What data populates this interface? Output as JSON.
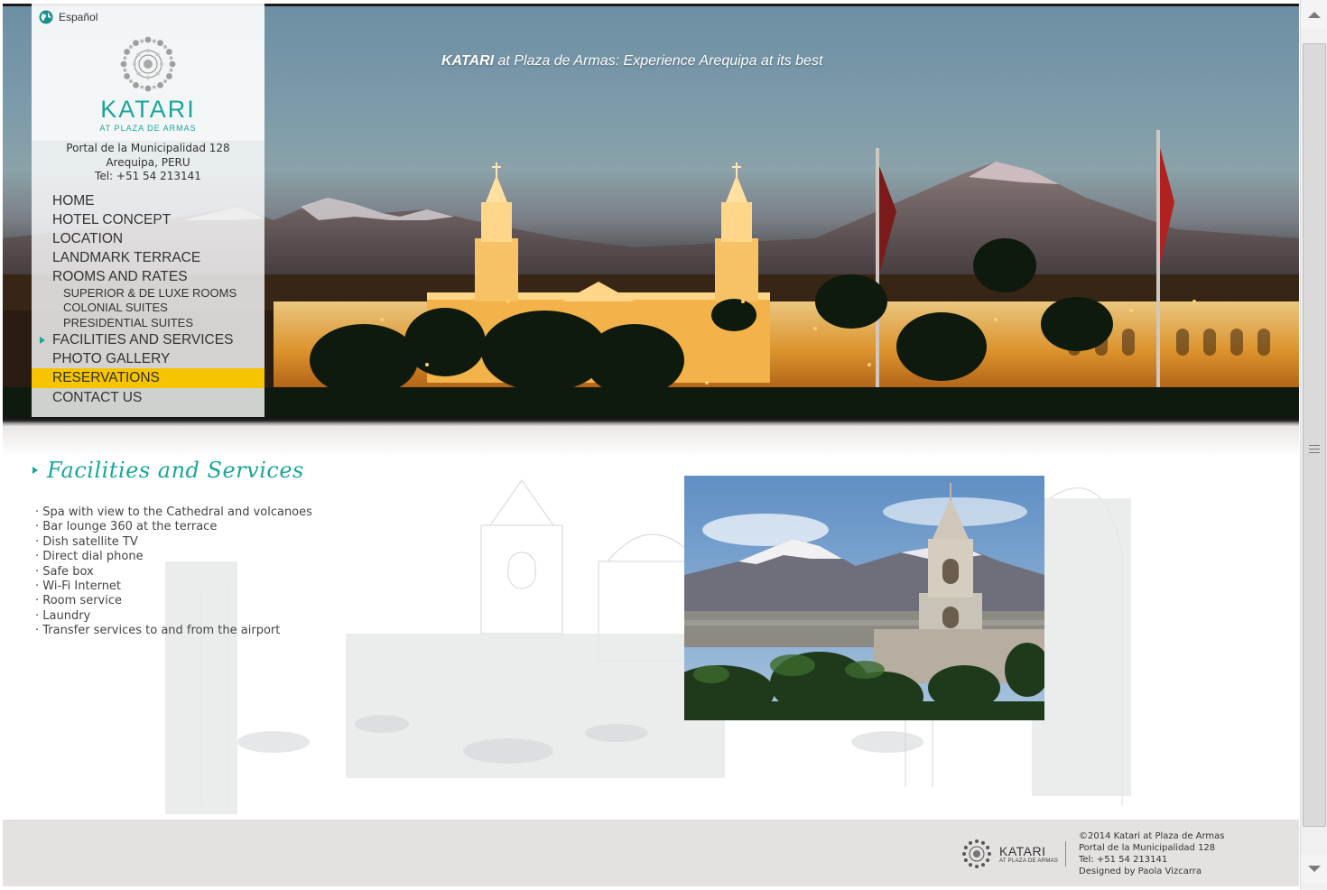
{
  "language_link": "Español",
  "brand": {
    "name": "KATARI",
    "subtitle": "AT PLAZA DE ARMAS",
    "accent_color": "#1aa59c",
    "highlight_color": "#f7c400"
  },
  "address": {
    "line1": "Portal de la Municipalidad 128",
    "line2": "Arequipa, PERU",
    "phone": "Tel: +51 54 213141"
  },
  "hero": {
    "tagline_brand": "KATARI",
    "tagline_rest": " at Plaza de Armas: Experience Arequipa at its best"
  },
  "nav": {
    "home": "HOME",
    "hotel_concept": "HOTEL CONCEPT",
    "location": "LOCATION",
    "landmark_terrace": "LANDMARK TERRACE",
    "rooms_and_rates": "ROOMS AND RATES",
    "superior_deluxe": "SUPERIOR & DE LUXE ROOMS",
    "colonial_suites": "COLONIAL SUITES",
    "presidential_suites": "PRESIDENTIAL SUITES",
    "facilities": "FACILITIES AND SERVICES",
    "photo_gallery": "PHOTO GALLERY",
    "reservations": "RESERVATIONS",
    "contact_us": "CONTACT US"
  },
  "section": {
    "title": "Facilities and Services",
    "items": [
      "· Spa with view to the Cathedral and volcanoes",
      "· Bar lounge 360 at the terrace",
      "· Dish satellite TV",
      "· Direct dial phone",
      "· Safe box",
      "· Wi-Fi Internet",
      "· Room service",
      "· Laundry",
      "· Transfer services to and from the airport"
    ]
  },
  "footer": {
    "logo_name": "KATARI",
    "logo_sub": "AT PLAZA DE ARMAS",
    "copyright": "©2014 Katari at Plaza de Armas",
    "address": "Portal de la Municipalidad 128",
    "phone": "Tel: +51 54 213141",
    "credit": "Designed by Paola Vizcarra"
  }
}
